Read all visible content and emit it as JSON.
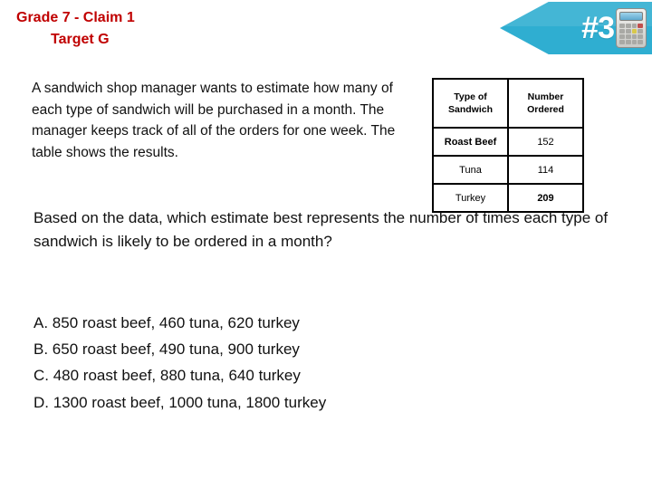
{
  "header": {
    "title_line_1": "Grade 7 - Claim 1",
    "title_line_2": "Target G",
    "title_color": "#C00000",
    "banner": {
      "number_label": "#3",
      "background_color": "#2FAED1",
      "icon_name": "calculator-icon"
    }
  },
  "stem": {
    "paragraph": "A sandwich shop manager wants to estimate how many of each type of sandwich will be purchased in a month. The manager keeps track of all of the orders for one week. The table shows the results."
  },
  "question": {
    "text": "Based on the data, which estimate best represents the number of times each type of sandwich is likely to be ordered in a month?"
  },
  "choices": [
    {
      "letter": "A.",
      "text": "850 roast beef, 460 tuna, 620 turkey",
      "full": "A. 850 roast beef, 460 tuna, 620 turkey"
    },
    {
      "letter": "B.",
      "text": "650 roast beef, 490 tuna, 900 turkey",
      "full": "B. 650 roast beef, 490 tuna, 900 turkey"
    },
    {
      "letter": "C.",
      "text": "480 roast beef, 880 tuna, 640 turkey",
      "full": "C. 480 roast beef, 880 tuna, 640 turkey"
    },
    {
      "letter": "D.",
      "text": "1300 roast beef, 1000 tuna, 1800 turkey",
      "full": "D. 1300 roast beef, 1000 tuna, 1800 turkey"
    }
  ],
  "chart_data": {
    "type": "table",
    "title": "",
    "columns": [
      "Type of Sandwich",
      "Number Ordered"
    ],
    "column_header_lines": [
      [
        "Type of",
        "Sandwich"
      ],
      [
        "Number",
        "Ordered"
      ]
    ],
    "categories": [
      "Roast Beef",
      "Tuna",
      "Turkey"
    ],
    "values": [
      152,
      114,
      209
    ],
    "rows": [
      {
        "label": "Roast Beef",
        "value": "152"
      },
      {
        "label": "Tuna",
        "value": "114"
      },
      {
        "label": "Turkey",
        "value": "209"
      }
    ],
    "xlabel": "Type of Sandwich",
    "ylabel": "Number Ordered",
    "grid": true,
    "legend": "none"
  }
}
